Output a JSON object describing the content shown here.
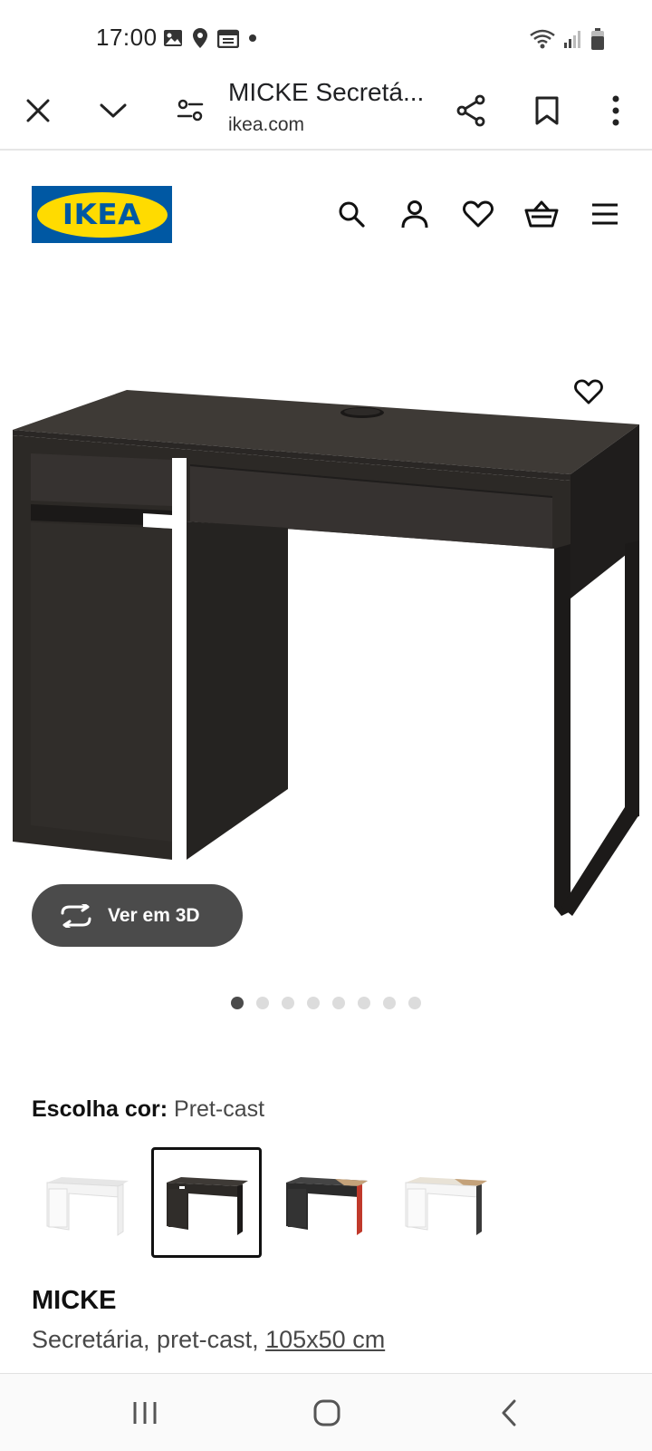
{
  "status_bar": {
    "time": "17:00",
    "icons_left": [
      "gallery-icon",
      "location-icon",
      "calendar-icon",
      "dot-icon"
    ],
    "icons_right": [
      "wifi-icon",
      "signal-icon",
      "battery-icon"
    ]
  },
  "browser": {
    "title": "MICKE Secretá...",
    "url": "ikea.com",
    "buttons": [
      "close-icon",
      "chevron-down-icon",
      "tune-icon",
      "share-icon",
      "bookmark-icon",
      "more-icon"
    ]
  },
  "header": {
    "logo_text": "IKEA",
    "brand_blue": "#0058a3",
    "brand_yellow": "#ffdb00",
    "icons": [
      "search-icon",
      "account-icon",
      "heart-icon",
      "basket-icon",
      "menu-icon"
    ]
  },
  "gallery": {
    "view_3d_label": "Ver em 3D",
    "image_count": 8,
    "active_index": 0
  },
  "color": {
    "label": "Escolha cor:",
    "value": "Pret-cast",
    "swatches": [
      {
        "name": "white",
        "selected": false
      },
      {
        "name": "pret-cast",
        "selected": true
      },
      {
        "name": "black-red",
        "selected": false
      },
      {
        "name": "white-anthracite",
        "selected": false
      }
    ]
  },
  "product": {
    "name": "MICKE",
    "description": "Secretária, pret-cast, ",
    "dimensions": "105x50 cm"
  },
  "nav": {
    "buttons": [
      "recent-apps-icon",
      "home-icon",
      "back-icon"
    ]
  }
}
